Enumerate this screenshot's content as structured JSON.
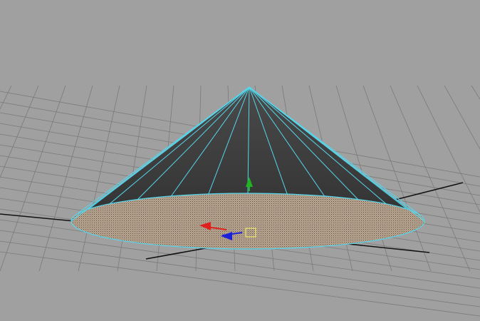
{
  "viewport": {
    "background_color": "#a0a0a0"
  },
  "scene": {
    "object": "cone",
    "selected": true,
    "wireframe_color": "#55d6ec",
    "grid_color": "#7a7a7a",
    "axis_line_color": "#111111",
    "cone_side_color_top": "#4a4a4a",
    "cone_side_color_bottom": "#2e2e2e",
    "cone_base_color": "#b7a590"
  },
  "manipulator": {
    "type": "move-tool",
    "x_axis_color": "#e0201c",
    "y_axis_color": "#21b321",
    "z_axis_color": "#1c22d8",
    "center_color": "#e8e870"
  }
}
